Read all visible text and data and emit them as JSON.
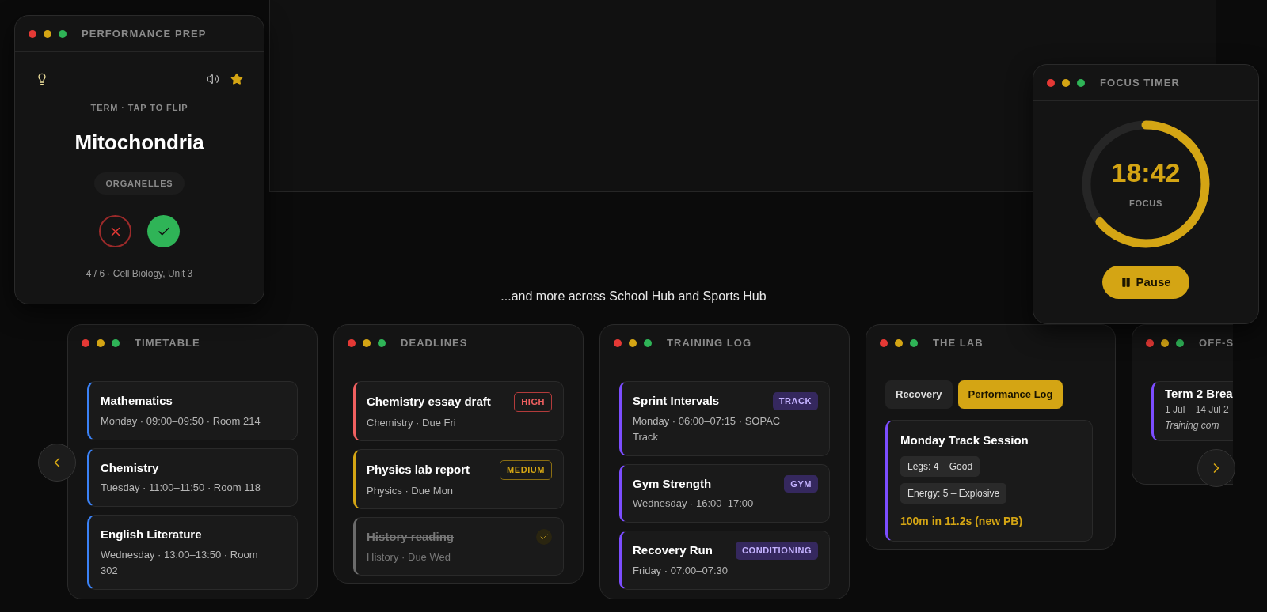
{
  "flashcard": {
    "title": "PERFORMANCE PREP",
    "starred": true,
    "prompt": "TERM · TAP TO FLIP",
    "term": "Mitochondria",
    "tag": "ORGANELLES",
    "progress": "4 / 6 · Cell Biology, Unit 3"
  },
  "focus_timer": {
    "title": "FOCUS TIMER",
    "time": "18:42",
    "label": "FOCUS",
    "level": 0.64,
    "button": "Pause"
  },
  "tagline": "...and more across School Hub and Sports Hub",
  "timetable": {
    "title": "TIMETABLE",
    "items": [
      {
        "name": "Mathematics",
        "details": "Monday · 09:00–09:50 · Room 214"
      },
      {
        "name": "Chemistry",
        "details": "Tuesday · 11:00–11:50 · Room 118"
      },
      {
        "name": "English Literature",
        "details": "Wednesday · 13:00–13:50 · Room 302"
      }
    ]
  },
  "deadlines": {
    "title": "DEADLINES",
    "items": [
      {
        "name": "Chemistry essay draft",
        "details": "Chemistry · Due Fri",
        "priority": "HIGH",
        "kind": "high",
        "done": false
      },
      {
        "name": "Physics lab report",
        "details": "Physics · Due Mon",
        "priority": "MEDIUM",
        "kind": "medium",
        "done": false
      },
      {
        "name": "History reading",
        "details": "History · Due Wed",
        "kind": "low",
        "done": true
      }
    ]
  },
  "training_log": {
    "title": "TRAINING LOG",
    "items": [
      {
        "name": "Sprint Intervals",
        "details": "Monday · 06:00–07:15 · SOPAC Track",
        "tag": "TRACK"
      },
      {
        "name": "Gym Strength",
        "details": "Wednesday · 16:00–17:00",
        "tag": "GYM"
      },
      {
        "name": "Recovery Run",
        "details": "Friday · 07:00–07:30",
        "tag": "CONDITIONING"
      }
    ]
  },
  "lab": {
    "title": "THE LAB",
    "tabs": [
      {
        "label": "Recovery",
        "selected": false
      },
      {
        "label": "Performance Log",
        "selected": true
      }
    ],
    "entry": {
      "title": "Monday Track Session",
      "chips": [
        "Legs: 4 – Good",
        "Energy: 5 – Explosive"
      ],
      "result": "100m in 11.2s (new PB)"
    }
  },
  "off_season": {
    "title": "OFF-S",
    "items": [
      {
        "name": "Term 2 Brea",
        "dates": "1 Jul – 14 Jul 2",
        "note": "Training com"
      }
    ]
  }
}
